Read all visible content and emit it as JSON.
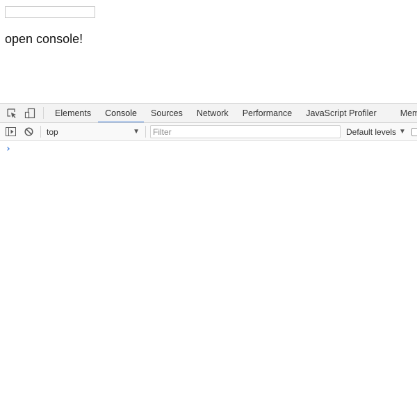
{
  "page": {
    "input_value": "",
    "heading": "open console!"
  },
  "devtools": {
    "toolbar_icons": [
      "inspect-element-icon",
      "device-toolbar-icon"
    ],
    "tabs": [
      {
        "label": "Elements",
        "active": false
      },
      {
        "label": "Console",
        "active": true
      },
      {
        "label": "Sources",
        "active": false
      },
      {
        "label": "Network",
        "active": false
      },
      {
        "label": "Performance",
        "active": false
      },
      {
        "label": "JavaScript Profiler",
        "active": false
      },
      {
        "label": "Memor",
        "active": false
      }
    ],
    "accent_color": "#3879d9"
  },
  "console": {
    "context": "top",
    "filter_placeholder": "Filter",
    "filter_value": "",
    "levels_label": "Default levels",
    "prompt_symbol": "›"
  }
}
